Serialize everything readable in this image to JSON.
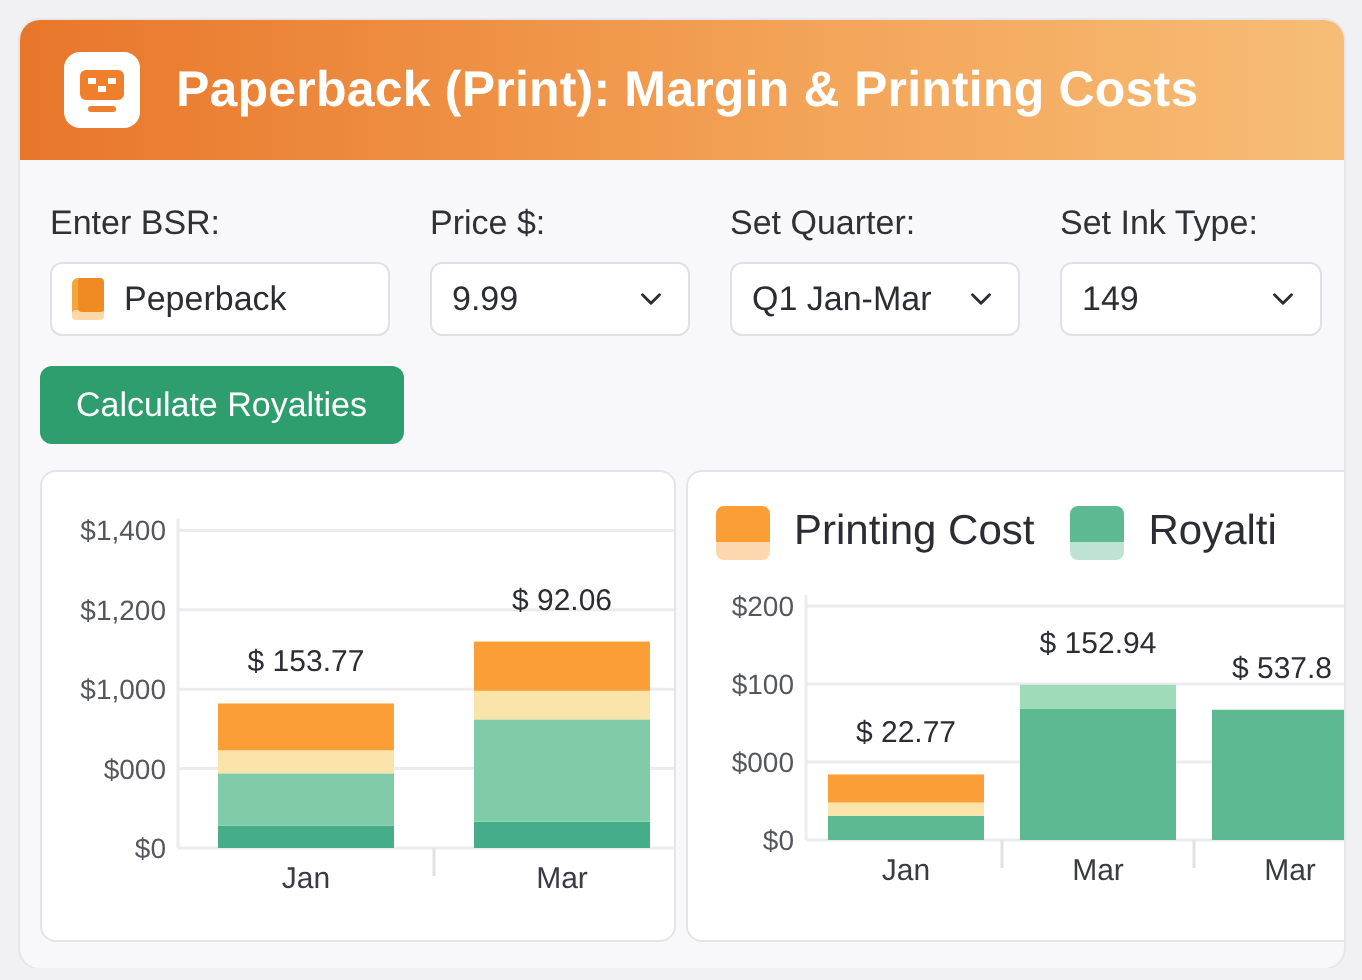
{
  "header": {
    "title": "Paperback (Print): Margin & Printing Costs"
  },
  "form": {
    "fields": [
      {
        "kind": "text",
        "label": "Enter BSR:",
        "value": "Peperback"
      },
      {
        "kind": "select",
        "label": "Price $:",
        "value": "9.99"
      },
      {
        "kind": "select",
        "label": "Set Quarter:",
        "value": "Q1 Jan-Mar"
      },
      {
        "kind": "select",
        "label": "Set Ink Type:",
        "value": "149"
      }
    ],
    "button": "Calculate Royalties"
  },
  "charts": [
    {
      "y_labels": [
        "$1,400",
        "$1,200",
        "$1,000",
        "$000",
        "$0"
      ],
      "x_labels": [
        "Jan",
        "Mar"
      ],
      "value_labels": [
        "$ 153.77",
        "$ 92.06"
      ]
    },
    {
      "legend": [
        {
          "label": "Printing Cost",
          "color": "#fb9e35"
        },
        {
          "label": "Royalti",
          "color": "#5cb991"
        }
      ],
      "y_labels": [
        "$200",
        "$100",
        "$000",
        "$0"
      ],
      "x_labels": [
        "Jan",
        "Mar",
        "Mar"
      ],
      "value_labels": [
        "$ 22.77",
        "$ 152.94",
        "$ 537.8"
      ]
    }
  ]
}
